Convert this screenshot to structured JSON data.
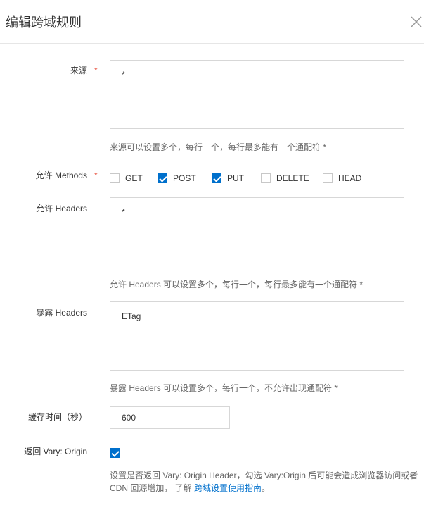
{
  "dialog": {
    "title": "编辑跨域规则"
  },
  "form": {
    "origin": {
      "label": "来源",
      "required_mark": "*",
      "value": "*",
      "help": "来源可以设置多个，每行一个，每行最多能有一个通配符 *"
    },
    "methods": {
      "label": "允许 Methods",
      "required_mark": "*",
      "options": [
        {
          "label": "GET",
          "checked": false
        },
        {
          "label": "POST",
          "checked": true
        },
        {
          "label": "PUT",
          "checked": true
        },
        {
          "label": "DELETE",
          "checked": false
        },
        {
          "label": "HEAD",
          "checked": false
        }
      ]
    },
    "allow_headers": {
      "label": "允许 Headers",
      "value": "*",
      "help": "允许 Headers 可以设置多个，每行一个，每行最多能有一个通配符 *"
    },
    "expose_headers": {
      "label": "暴露 Headers",
      "value": "ETag",
      "help": "暴露 Headers 可以设置多个，每行一个，不允许出现通配符 *"
    },
    "cache_time": {
      "label": "缓存时间（秒）",
      "value": "600"
    },
    "vary_origin": {
      "label": "返回 Vary: Origin",
      "checked": true,
      "help_text": "设置是否返回 Vary: Origin Header，勾选 Vary:Origin 后可能会造成浏览器访问或者 CDN 回源增加， 了解 ",
      "help_link": "跨域设置使用指南",
      "help_end": "。"
    }
  }
}
